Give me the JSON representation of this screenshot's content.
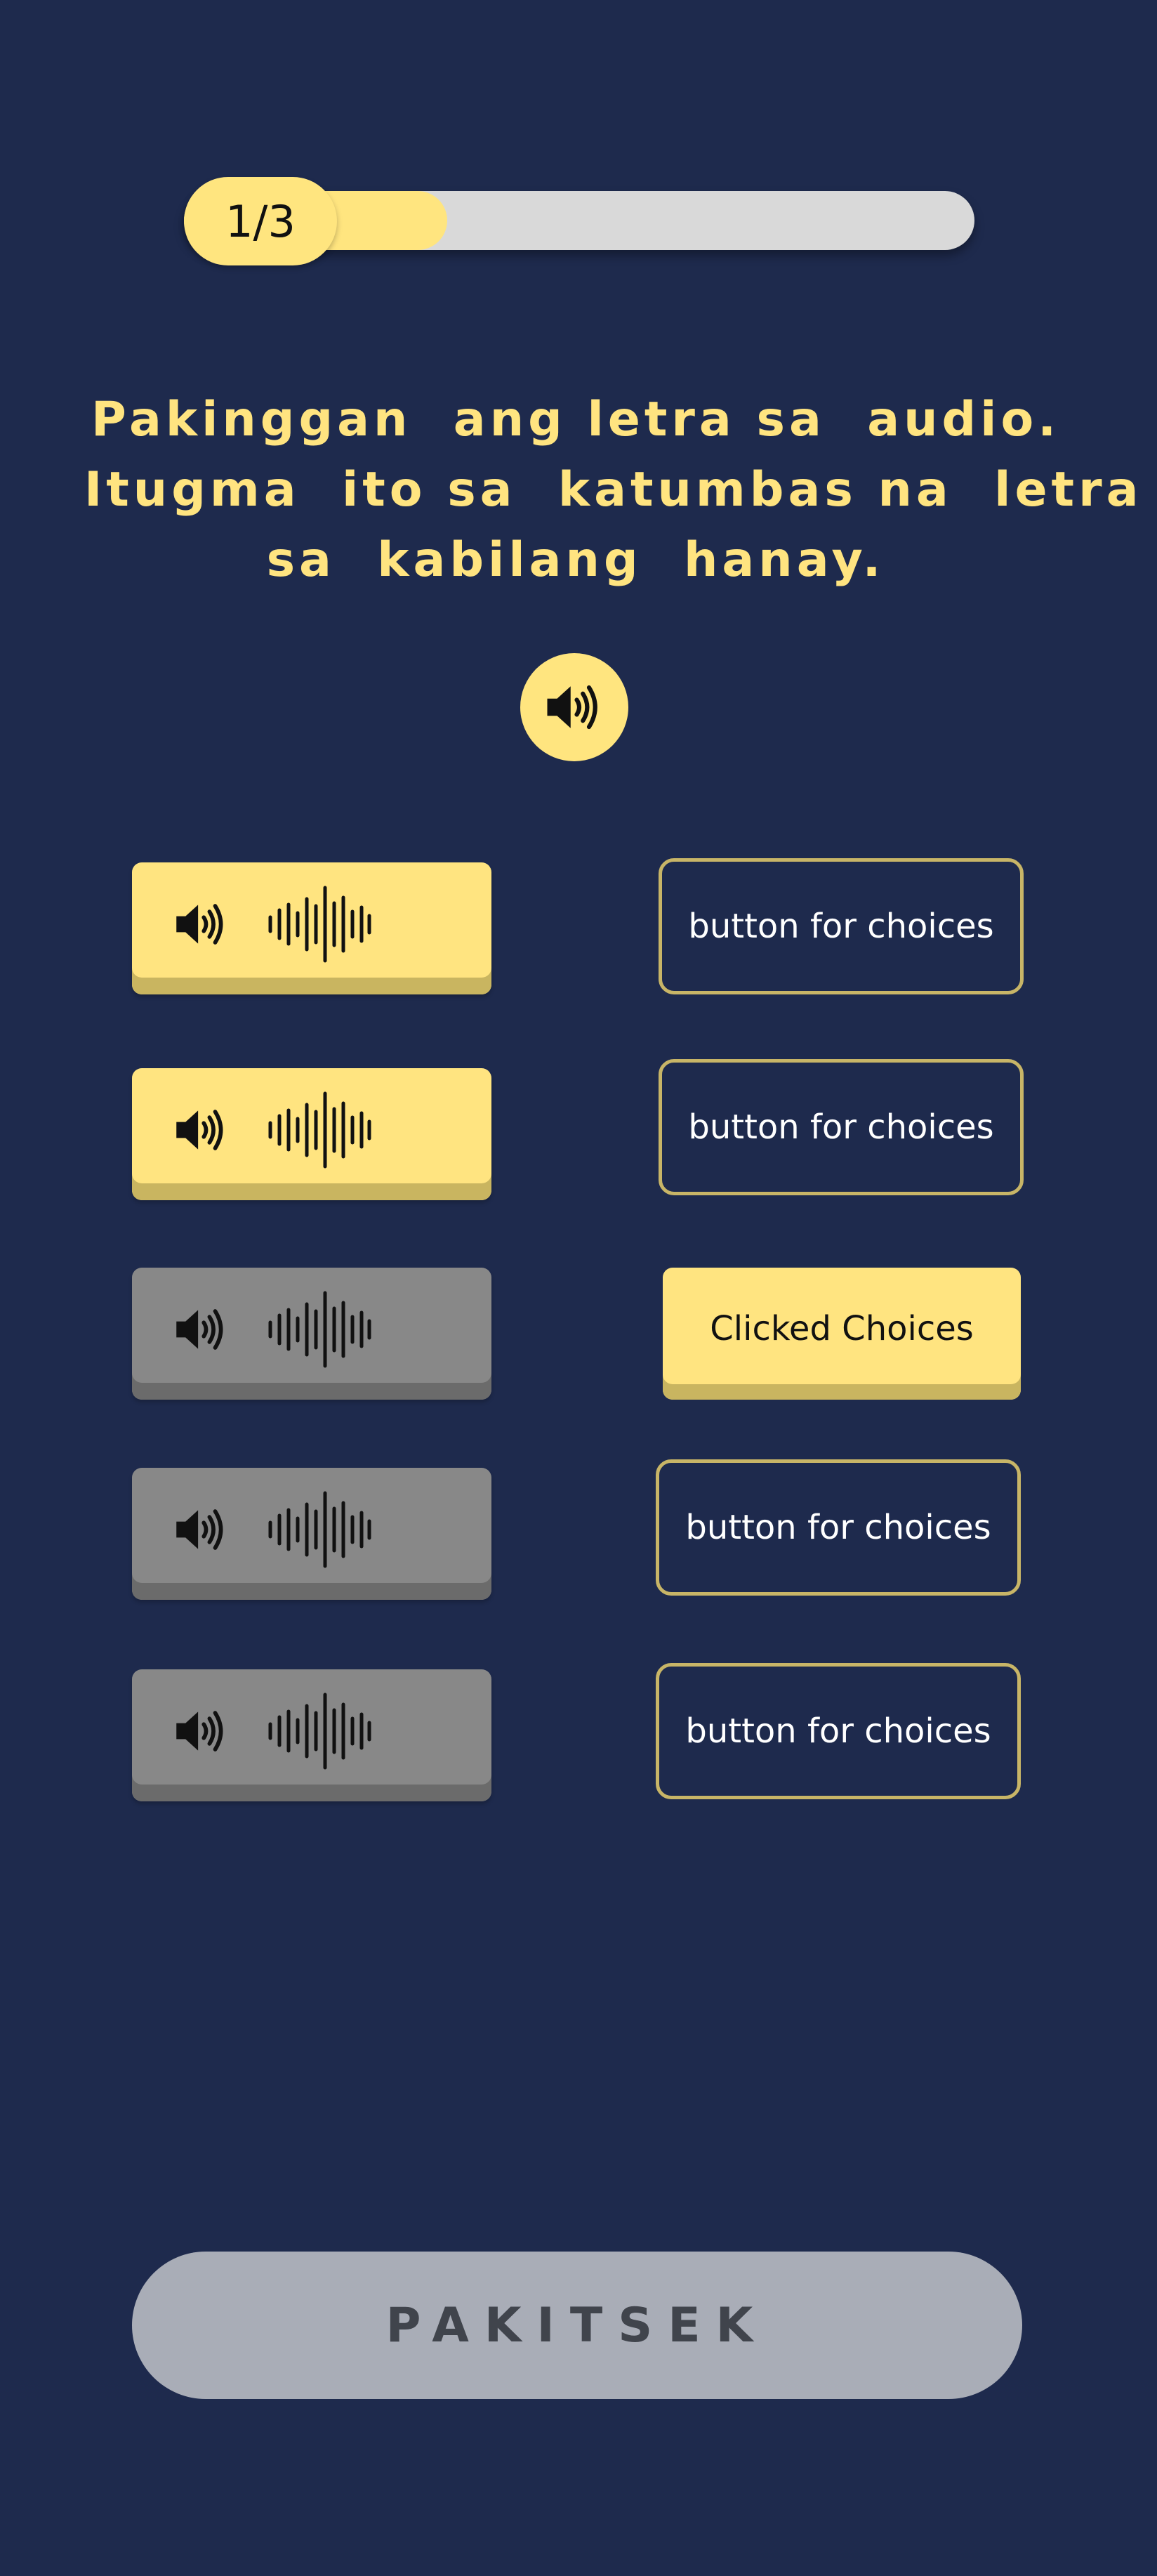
{
  "progress": {
    "label": "1/3",
    "fraction": 0.333
  },
  "instruction": {
    "lines": [
      "Pakinggan  ang letra sa  audio.",
      "Itugma  ito sa  katumbas na  letra",
      "sa  kabilang  hanay."
    ]
  },
  "main_audio": {
    "icon": "speaker-icon"
  },
  "audio_items": [
    {
      "state": "active",
      "icons": [
        "speaker-icon",
        "waveform-icon"
      ]
    },
    {
      "state": "active",
      "icons": [
        "speaker-icon",
        "waveform-icon"
      ]
    },
    {
      "state": "inactive",
      "icons": [
        "speaker-icon",
        "waveform-icon"
      ]
    },
    {
      "state": "inactive",
      "icons": [
        "speaker-icon",
        "waveform-icon"
      ]
    },
    {
      "state": "inactive",
      "icons": [
        "speaker-icon",
        "waveform-icon"
      ]
    }
  ],
  "choices": [
    {
      "label": "button for choices",
      "state": "default"
    },
    {
      "label": "button for choices",
      "state": "default"
    },
    {
      "label": "Clicked Choices",
      "state": "clicked"
    },
    {
      "label": "button for choices",
      "state": "default"
    },
    {
      "label": "button for choices",
      "state": "default"
    }
  ],
  "check_button": {
    "label": "PAKITSEK"
  },
  "colors": {
    "background": "#1e2a4d",
    "accent": "#ffe480",
    "inactive": "#888888",
    "choice_border": "#c8b567",
    "check_button": "#a9adb7"
  }
}
